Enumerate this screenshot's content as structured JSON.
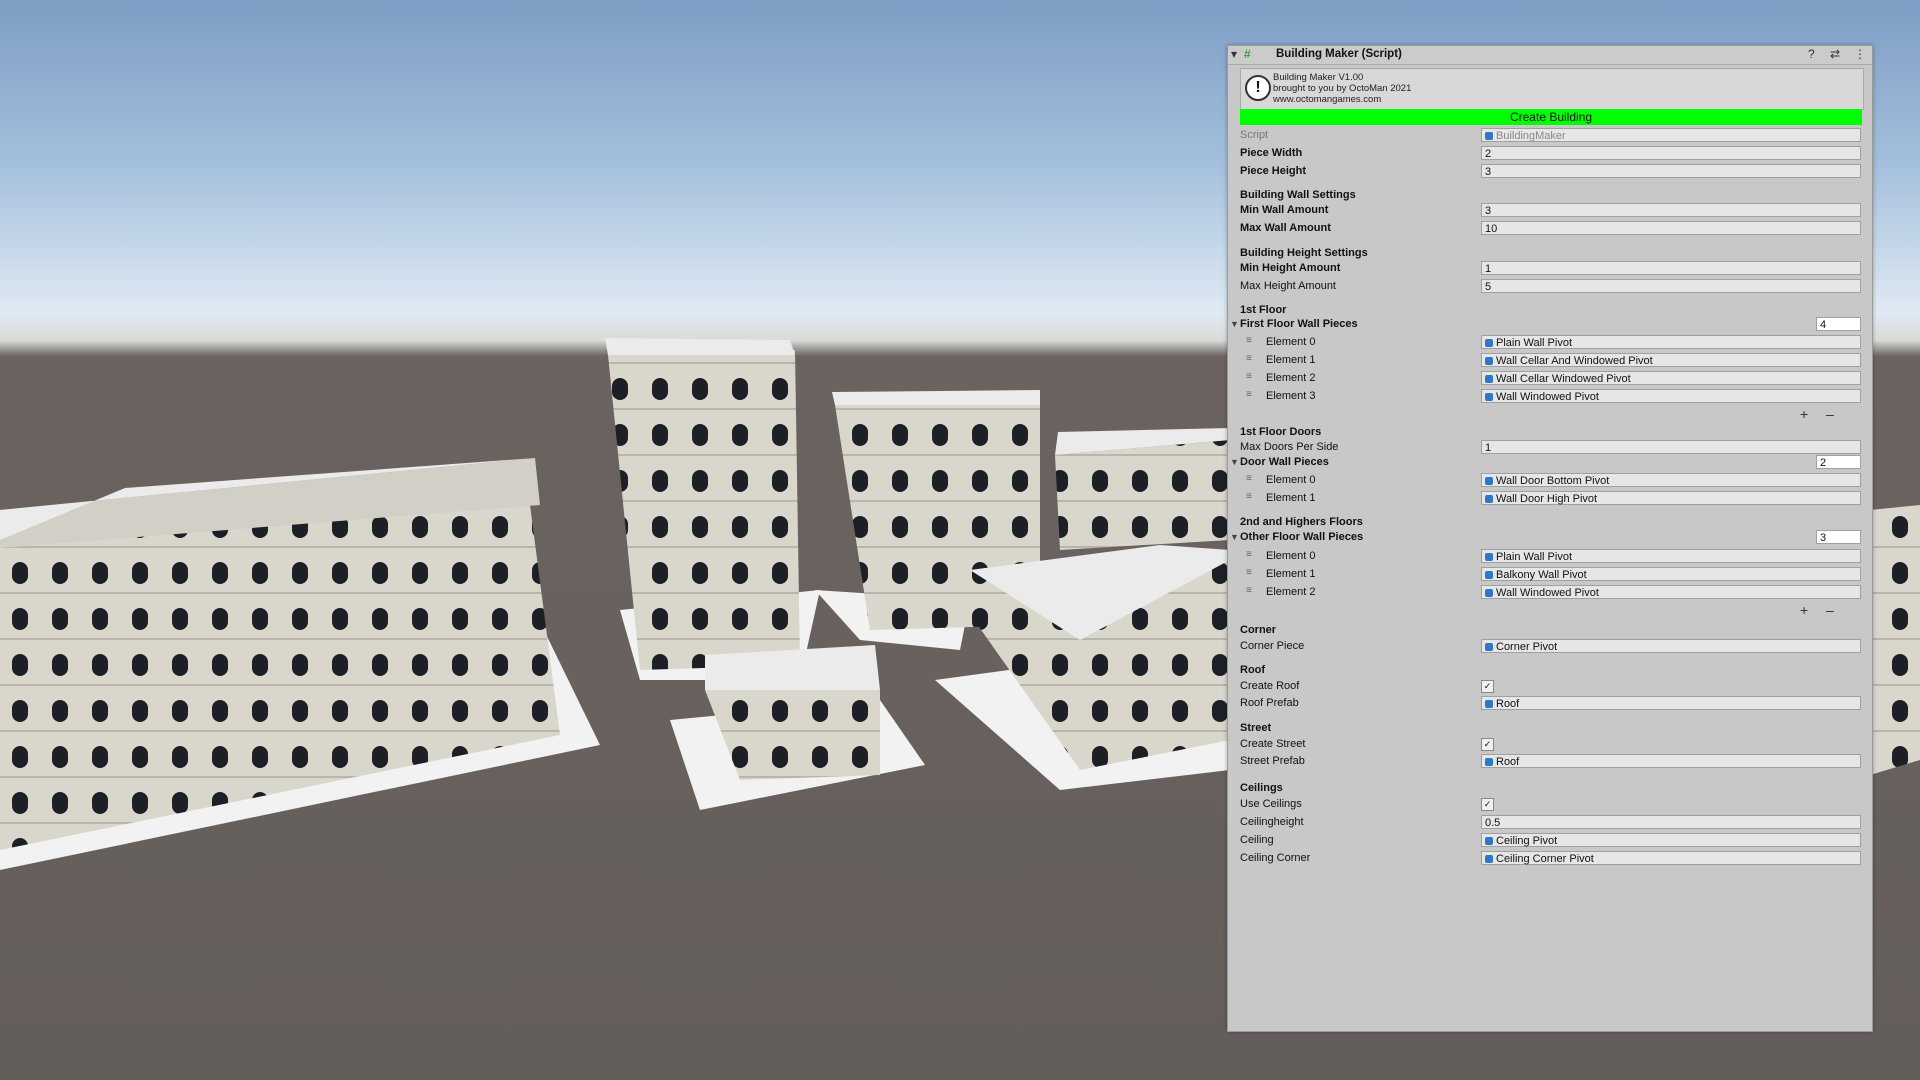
{
  "inspector": {
    "title": "Building Maker (Script)",
    "info_lines": [
      "Building Maker V1.00",
      "brought to you by OctoMan 2021",
      "www.octomangames.com"
    ],
    "create_button": "Create Building",
    "script_label": "Script",
    "script_value": "BuildingMaker",
    "piece_width_label": "Piece Width",
    "piece_width": "2",
    "piece_height_label": "Piece Height",
    "piece_height": "3",
    "wall_settings_header": "Building Wall Settings",
    "min_wall_label": "Min Wall Amount",
    "min_wall": "3",
    "max_wall_label": "Max Wall Amount",
    "max_wall": "10",
    "height_settings_header": "Building Height Settings",
    "min_height_label": "Min Height Amount",
    "min_height": "1",
    "max_height_label": "Max Height Amount",
    "max_height": "5",
    "first_floor_header": "1st Floor",
    "first_floor_list_label": "First Floor Wall Pieces",
    "first_floor_count": "4",
    "first_floor_elements": [
      "Element 0",
      "Element 1",
      "Element 2",
      "Element 3"
    ],
    "first_floor_values": [
      "Plain Wall Pivot",
      "Wall Cellar And Windowed Pivot",
      "Wall Cellar Windowed Pivot",
      "Wall Windowed Pivot"
    ],
    "doors_header": "1st Floor Doors",
    "max_doors_label": "Max Doors Per Side",
    "max_doors": "1",
    "door_list_label": "Door Wall Pieces",
    "door_count": "2",
    "door_elements": [
      "Element 0",
      "Element 1"
    ],
    "door_values": [
      "Wall Door Bottom Pivot",
      "Wall Door High Pivot"
    ],
    "other_header": "2nd and Highers Floors",
    "other_list_label": "Other Floor Wall Pieces",
    "other_count": "3",
    "other_elements": [
      "Element 0",
      "Element 1",
      "Element 2"
    ],
    "other_values": [
      "Plain Wall Pivot",
      "Balkony Wall Pivot",
      "Wall Windowed Pivot"
    ],
    "corner_header": "Corner",
    "corner_piece_label": "Corner Piece",
    "corner_piece": "Corner Pivot",
    "roof_header": "Roof",
    "create_roof_label": "Create Roof",
    "roof_prefab_label": "Roof Prefab",
    "roof_prefab": "Roof",
    "street_header": "Street",
    "create_street_label": "Create Street",
    "street_prefab_label": "Street Prefab",
    "street_prefab": "Roof",
    "ceilings_header": "Ceilings",
    "use_ceilings_label": "Use Ceilings",
    "ceiling_height_label": "Ceilingheight",
    "ceiling_height": "0.5",
    "ceiling_label": "Ceiling",
    "ceiling_value": "Ceiling Pivot",
    "ceiling_corner_label": "Ceiling Corner",
    "ceiling_corner_value": "Ceiling Corner Pivot",
    "checkmark": "✓",
    "plus": "+",
    "minus": "–",
    "exclaim": "!"
  },
  "colors": {
    "create_button": "#00ff00",
    "object_icon": "#2f78c8",
    "ground": "#645e5b",
    "sky_top": "#7d9dc4"
  }
}
